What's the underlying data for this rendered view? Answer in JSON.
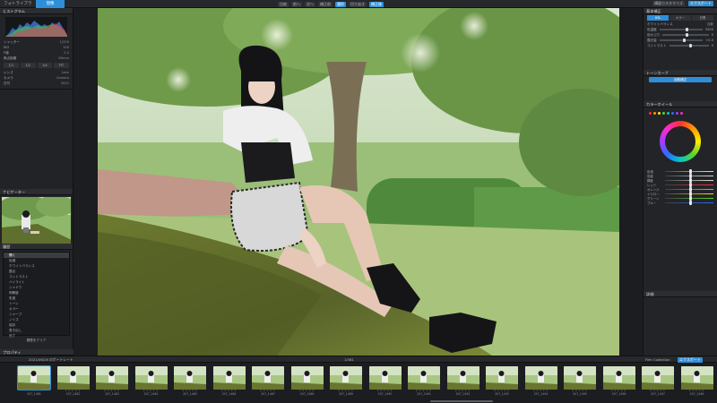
{
  "topbar": {
    "tabs": [
      "フォトライブラリ",
      "現像"
    ],
    "active_tab": 1,
    "center_buttons": [
      "比較",
      "前へ",
      "次へ",
      "補正前",
      "選択",
      "切り抜き",
      "補正後"
    ],
    "right_buttons": [
      "構図カスタマイズ",
      "エクスポート"
    ]
  },
  "left_panel": {
    "histogram_header": "ヒストグラム",
    "exif_rows": [
      {
        "label": "シャッター",
        "value": "1/250"
      },
      {
        "label": "ISO",
        "value": "100"
      },
      {
        "label": "F値",
        "value": "2.0"
      },
      {
        "label": "焦点距離",
        "value": "85mm"
      }
    ],
    "info_rows": [
      {
        "label": "レンズ",
        "value": "Lens"
      },
      {
        "label": "カメラ",
        "value": "Camera"
      },
      {
        "label": "日付",
        "value": "2021"
      }
    ],
    "buttons": [
      "1/1",
      "1/2",
      "1/4",
      "FIT"
    ],
    "navigator_header": "ナビゲーター",
    "history_header": "履歴",
    "history_items": [
      "開く",
      "色調",
      "ホワイトバランス",
      "露出",
      "コントラスト",
      "ハイライト",
      "シャドウ",
      "明瞭度",
      "彩度",
      "トーン",
      "カラー",
      "シャープ",
      "ノイズ",
      "保存",
      "書き出し",
      "完了"
    ],
    "bottom_label": "履歴をクリア",
    "footer_header": "プロパティ"
  },
  "right_panel": {
    "header": "基本補正",
    "rows": [
      {
        "label": "ホワイトバランス",
        "value": "自動"
      },
      {
        "label": "色温度",
        "value": "5500"
      },
      {
        "label": "色かぶり",
        "value": "0"
      },
      {
        "label": "露光量",
        "value": "+0.3"
      },
      {
        "label": "コントラスト",
        "value": "0"
      }
    ],
    "button_label": "自動補正",
    "tone_header": "トーンカーブ",
    "seg_labels": [
      "HSL",
      "カラー",
      "白黒"
    ],
    "color_header": "カラーホイール",
    "hsl_rows": [
      "色相",
      "彩度",
      "輝度",
      "レッド",
      "オレンジ",
      "イエロー",
      "グリーン",
      "ブルー"
    ],
    "footer_header": "詳細"
  },
  "strip": {
    "left_text": "2021/06/26 のポートレート",
    "count_text": "1/381",
    "right_text": "Film Collection",
    "thumbs": [
      "207_1481",
      "207_1482",
      "207_1483",
      "207_1484",
      "207_1485",
      "207_1486",
      "207_1487",
      "207_1488",
      "207_1489",
      "207_1490",
      "207_1491",
      "207_1492",
      "207_1493",
      "207_1494",
      "207_1495",
      "207_1496",
      "207_1497",
      "207_1498"
    ]
  },
  "colors": {
    "accent": "#2e8ed8",
    "panel": "#232427",
    "background": "#1c1d20"
  }
}
